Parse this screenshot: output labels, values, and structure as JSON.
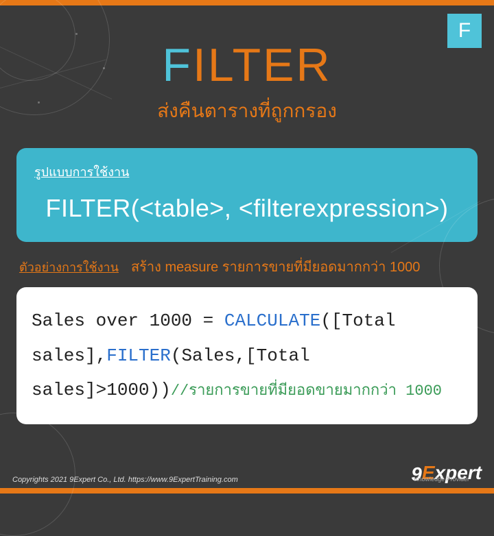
{
  "badge": "F",
  "title": {
    "first": "F",
    "rest": "ILTER"
  },
  "subtitle": "ส่งคืนตารางที่ถูกกรอง",
  "syntax": {
    "label": "รูปแบบการใช้งาน",
    "text": "FILTER(<table>, <filterexpression>)"
  },
  "example": {
    "label": "ตัวอย่างการใช้งาน",
    "description": "สร้าง measure รายการขายที่มียอดมากกว่า 1000",
    "code_plain_prefix": "Sales over 1000 = ",
    "code_kw1": "CALCULATE",
    "code_plain_1": "([Total sales],",
    "code_kw2": "FILTER",
    "code_plain_2": "(Sales,[Total sales]>1000))",
    "code_comment": "//รายการขายที่มียอดขายมากกว่า 1000"
  },
  "footer": {
    "copyright": "Copyrights 2021 9Expert Co., Ltd.   https://www.9ExpertTraining.com",
    "logo_nine": "9",
    "logo_e": "E",
    "logo_xpert": "xpert",
    "logo_sub": "Knowledge Provider"
  }
}
